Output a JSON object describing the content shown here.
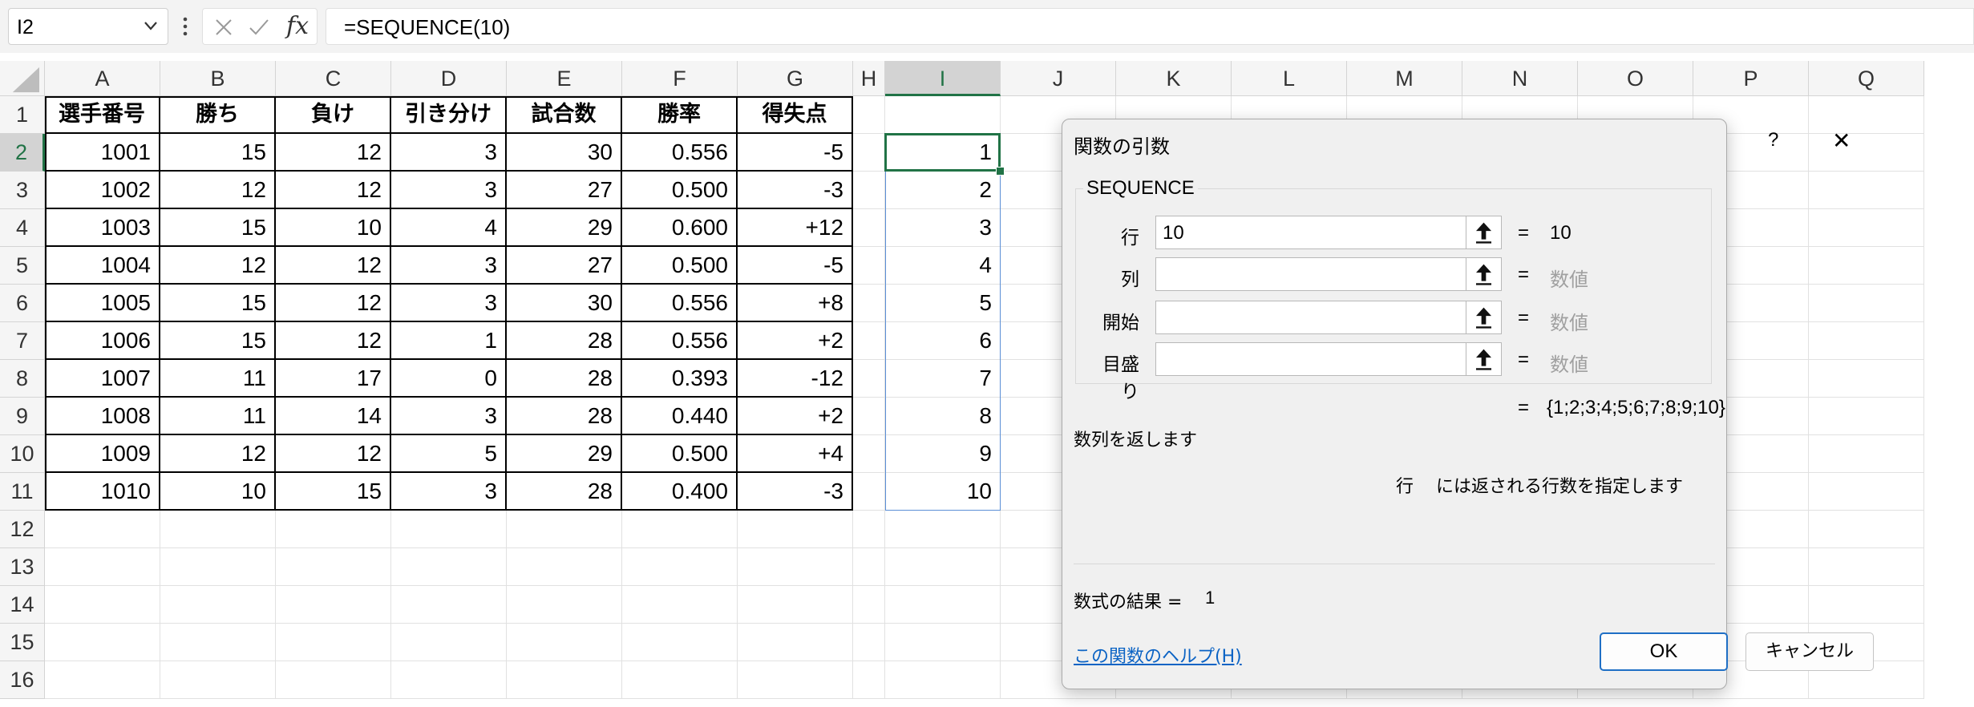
{
  "formula_bar": {
    "name_box": "I2",
    "formula": "=SEQUENCE(10)",
    "fx_label": "fx"
  },
  "grid": {
    "columns": [
      "A",
      "B",
      "C",
      "D",
      "E",
      "F",
      "G",
      "H",
      "I",
      "J",
      "K",
      "L",
      "M",
      "N",
      "O",
      "P",
      "Q"
    ],
    "selected_column": "I",
    "rows": [
      "1",
      "2",
      "3",
      "4",
      "5",
      "6",
      "7",
      "8",
      "9",
      "10",
      "11",
      "12",
      "13",
      "14",
      "15",
      "16"
    ],
    "selected_row": "2",
    "table_headers": [
      "選手番号",
      "勝ち",
      "負け",
      "引き分け",
      "試合数",
      "勝率",
      "得失点"
    ],
    "table_rows": [
      [
        "1001",
        "15",
        "12",
        "3",
        "30",
        "0.556",
        "-5"
      ],
      [
        "1002",
        "12",
        "12",
        "3",
        "27",
        "0.500",
        "-3"
      ],
      [
        "1003",
        "15",
        "10",
        "4",
        "29",
        "0.600",
        "+12"
      ],
      [
        "1004",
        "12",
        "12",
        "3",
        "27",
        "0.500",
        "-5"
      ],
      [
        "1005",
        "15",
        "12",
        "3",
        "30",
        "0.556",
        "+8"
      ],
      [
        "1006",
        "15",
        "12",
        "1",
        "28",
        "0.556",
        "+2"
      ],
      [
        "1007",
        "11",
        "17",
        "0",
        "28",
        "0.393",
        "-12"
      ],
      [
        "1008",
        "11",
        "14",
        "3",
        "28",
        "0.440",
        "+2"
      ],
      [
        "1009",
        "12",
        "12",
        "5",
        "29",
        "0.500",
        "+4"
      ],
      [
        "1010",
        "10",
        "15",
        "3",
        "28",
        "0.400",
        "-3"
      ]
    ],
    "sequence_values": [
      "1",
      "2",
      "3",
      "4",
      "5",
      "6",
      "7",
      "8",
      "9",
      "10"
    ]
  },
  "dialog": {
    "title": "関数の引数",
    "help_button": "?",
    "close_button": "✕",
    "function_name": "SEQUENCE",
    "args": [
      {
        "label": "行",
        "value": "10",
        "result": "10",
        "hint": false
      },
      {
        "label": "列",
        "value": "",
        "result": "数値",
        "hint": true
      },
      {
        "label": "開始",
        "value": "",
        "result": "数値",
        "hint": true
      },
      {
        "label": "目盛り",
        "value": "",
        "result": "数値",
        "hint": true
      }
    ],
    "equals": "=",
    "array_result": "{1;2;3;4;5;6;7;8;9;10}",
    "description": "数列を返します",
    "arg_help_name": "行",
    "arg_help_text": "には返される行数を指定します",
    "formula_result_label": "数式の結果 =",
    "formula_result_value": "1",
    "help_link": "この関数のヘルプ(H)",
    "ok_label": "OK",
    "cancel_label": "キャンセル"
  }
}
